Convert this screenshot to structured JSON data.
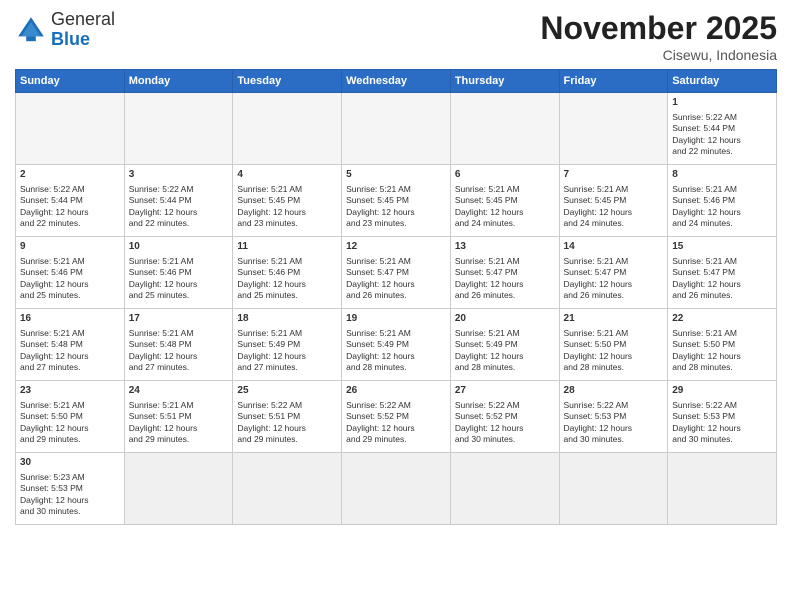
{
  "header": {
    "logo_general": "General",
    "logo_blue": "Blue",
    "month_title": "November 2025",
    "location": "Cisewu, Indonesia"
  },
  "weekdays": [
    "Sunday",
    "Monday",
    "Tuesday",
    "Wednesday",
    "Thursday",
    "Friday",
    "Saturday"
  ],
  "weeks": [
    [
      {
        "day": "",
        "info": ""
      },
      {
        "day": "",
        "info": ""
      },
      {
        "day": "",
        "info": ""
      },
      {
        "day": "",
        "info": ""
      },
      {
        "day": "",
        "info": ""
      },
      {
        "day": "",
        "info": ""
      },
      {
        "day": "1",
        "info": "Sunrise: 5:22 AM\nSunset: 5:44 PM\nDaylight: 12 hours\nand 22 minutes."
      }
    ],
    [
      {
        "day": "2",
        "info": "Sunrise: 5:22 AM\nSunset: 5:44 PM\nDaylight: 12 hours\nand 22 minutes."
      },
      {
        "day": "3",
        "info": "Sunrise: 5:22 AM\nSunset: 5:44 PM\nDaylight: 12 hours\nand 22 minutes."
      },
      {
        "day": "4",
        "info": "Sunrise: 5:21 AM\nSunset: 5:45 PM\nDaylight: 12 hours\nand 23 minutes."
      },
      {
        "day": "5",
        "info": "Sunrise: 5:21 AM\nSunset: 5:45 PM\nDaylight: 12 hours\nand 23 minutes."
      },
      {
        "day": "6",
        "info": "Sunrise: 5:21 AM\nSunset: 5:45 PM\nDaylight: 12 hours\nand 24 minutes."
      },
      {
        "day": "7",
        "info": "Sunrise: 5:21 AM\nSunset: 5:45 PM\nDaylight: 12 hours\nand 24 minutes."
      },
      {
        "day": "8",
        "info": "Sunrise: 5:21 AM\nSunset: 5:46 PM\nDaylight: 12 hours\nand 24 minutes."
      }
    ],
    [
      {
        "day": "9",
        "info": "Sunrise: 5:21 AM\nSunset: 5:46 PM\nDaylight: 12 hours\nand 25 minutes."
      },
      {
        "day": "10",
        "info": "Sunrise: 5:21 AM\nSunset: 5:46 PM\nDaylight: 12 hours\nand 25 minutes."
      },
      {
        "day": "11",
        "info": "Sunrise: 5:21 AM\nSunset: 5:46 PM\nDaylight: 12 hours\nand 25 minutes."
      },
      {
        "day": "12",
        "info": "Sunrise: 5:21 AM\nSunset: 5:47 PM\nDaylight: 12 hours\nand 26 minutes."
      },
      {
        "day": "13",
        "info": "Sunrise: 5:21 AM\nSunset: 5:47 PM\nDaylight: 12 hours\nand 26 minutes."
      },
      {
        "day": "14",
        "info": "Sunrise: 5:21 AM\nSunset: 5:47 PM\nDaylight: 12 hours\nand 26 minutes."
      },
      {
        "day": "15",
        "info": "Sunrise: 5:21 AM\nSunset: 5:47 PM\nDaylight: 12 hours\nand 26 minutes."
      }
    ],
    [
      {
        "day": "16",
        "info": "Sunrise: 5:21 AM\nSunset: 5:48 PM\nDaylight: 12 hours\nand 27 minutes."
      },
      {
        "day": "17",
        "info": "Sunrise: 5:21 AM\nSunset: 5:48 PM\nDaylight: 12 hours\nand 27 minutes."
      },
      {
        "day": "18",
        "info": "Sunrise: 5:21 AM\nSunset: 5:49 PM\nDaylight: 12 hours\nand 27 minutes."
      },
      {
        "day": "19",
        "info": "Sunrise: 5:21 AM\nSunset: 5:49 PM\nDaylight: 12 hours\nand 28 minutes."
      },
      {
        "day": "20",
        "info": "Sunrise: 5:21 AM\nSunset: 5:49 PM\nDaylight: 12 hours\nand 28 minutes."
      },
      {
        "day": "21",
        "info": "Sunrise: 5:21 AM\nSunset: 5:50 PM\nDaylight: 12 hours\nand 28 minutes."
      },
      {
        "day": "22",
        "info": "Sunrise: 5:21 AM\nSunset: 5:50 PM\nDaylight: 12 hours\nand 28 minutes."
      }
    ],
    [
      {
        "day": "23",
        "info": "Sunrise: 5:21 AM\nSunset: 5:50 PM\nDaylight: 12 hours\nand 29 minutes."
      },
      {
        "day": "24",
        "info": "Sunrise: 5:21 AM\nSunset: 5:51 PM\nDaylight: 12 hours\nand 29 minutes."
      },
      {
        "day": "25",
        "info": "Sunrise: 5:22 AM\nSunset: 5:51 PM\nDaylight: 12 hours\nand 29 minutes."
      },
      {
        "day": "26",
        "info": "Sunrise: 5:22 AM\nSunset: 5:52 PM\nDaylight: 12 hours\nand 29 minutes."
      },
      {
        "day": "27",
        "info": "Sunrise: 5:22 AM\nSunset: 5:52 PM\nDaylight: 12 hours\nand 30 minutes."
      },
      {
        "day": "28",
        "info": "Sunrise: 5:22 AM\nSunset: 5:53 PM\nDaylight: 12 hours\nand 30 minutes."
      },
      {
        "day": "29",
        "info": "Sunrise: 5:22 AM\nSunset: 5:53 PM\nDaylight: 12 hours\nand 30 minutes."
      }
    ],
    [
      {
        "day": "30",
        "info": "Sunrise: 5:23 AM\nSunset: 5:53 PM\nDaylight: 12 hours\nand 30 minutes."
      },
      {
        "day": "",
        "info": ""
      },
      {
        "day": "",
        "info": ""
      },
      {
        "day": "",
        "info": ""
      },
      {
        "day": "",
        "info": ""
      },
      {
        "day": "",
        "info": ""
      },
      {
        "day": "",
        "info": ""
      }
    ]
  ]
}
